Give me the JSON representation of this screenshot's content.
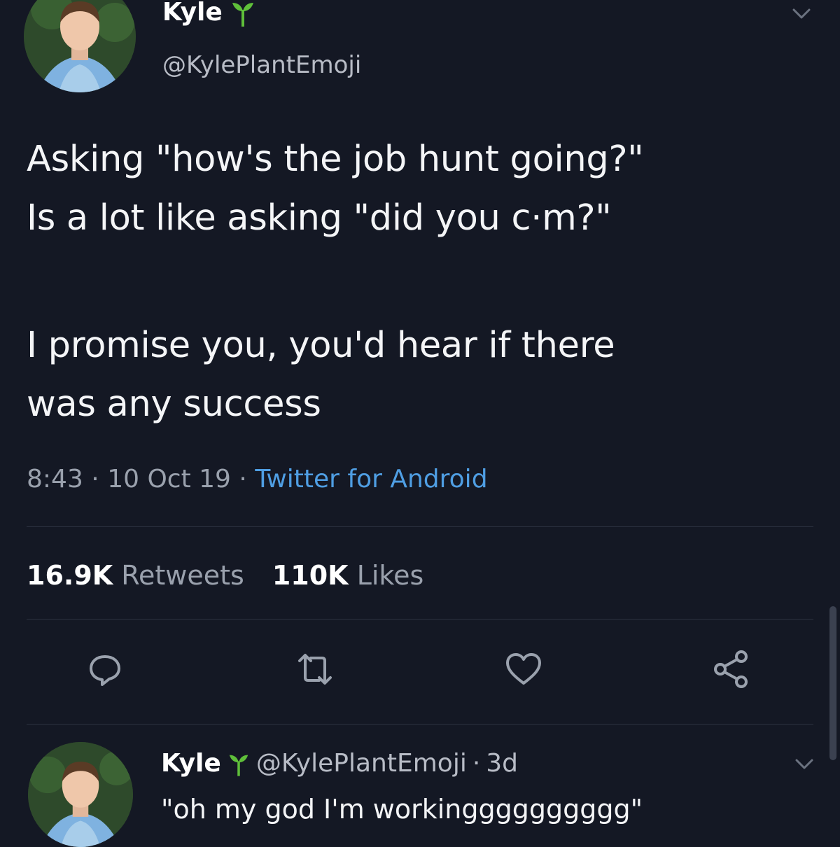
{
  "tweet": {
    "author_name": "Kyle",
    "author_handle": "@KylePlantEmoji",
    "text_lines_1": [
      "Asking \"how's the job hunt going?\"",
      "Is a lot like asking \"did you c·m?\""
    ],
    "text_lines_2": [
      "I promise you, you'd hear if there",
      "was any success"
    ],
    "time": "8:43",
    "date": "10 Oct 19",
    "separator": "·",
    "source": "Twitter for Android",
    "retweets_count": "16.9K",
    "retweets_label": "Retweets",
    "likes_count": "110K",
    "likes_label": "Likes"
  },
  "actions": {
    "reply_icon": "reply-icon",
    "retweet_icon": "retweet-icon",
    "like_icon": "heart-icon",
    "share_icon": "share-icon"
  },
  "reply": {
    "author_name": "Kyle",
    "author_handle": "@KylePlantEmoji",
    "age": "3d",
    "text": "\"oh my god I'm workingggggggggg\""
  },
  "colors": {
    "background": "#141824",
    "link": "#4f9ee3",
    "muted": "#9aa1ad",
    "sprout": "#5fbf3a"
  }
}
